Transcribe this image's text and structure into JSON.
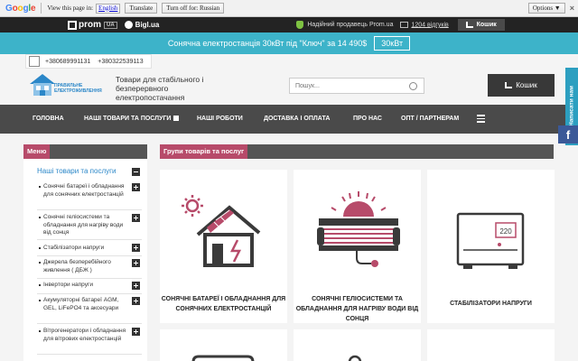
{
  "translate_bar": {
    "logo": "Google",
    "prompt": "View this page in:",
    "language": "English",
    "translate_label": "Translate",
    "turn_off_label": "Turn off for: Russian",
    "options_label": "Options ▼",
    "close": "×"
  },
  "prom_bar": {
    "prom_label": "prom",
    "prom_ua": "UA",
    "bigl_label": "Bigl.ua",
    "seller_text": "Надійний продавець Prom.ua",
    "reviews_text": "1204 відгуків",
    "cart_label": "Кошик"
  },
  "promo": {
    "text": "Сонячна електростанція 30кВт під \"Ключ\" за 14 490$",
    "button_label": "30кВт"
  },
  "phones": [
    "+380689991131",
    "+380322539113"
  ],
  "header": {
    "logo_text_1": "ПРАВИЛЬНЕ",
    "logo_text_2": "ЕЛЕКТРОЖИВЛЕННЯ",
    "tagline": "Товари для стабільного і безперервного електропостачання",
    "search_placeholder": "Пошук...",
    "cart_label": "Кошик"
  },
  "nav": {
    "items": [
      "ГОЛОВНА",
      "НАШІ ТОВАРИ ТА ПОСЛУГИ",
      "НАШІ РОБОТИ",
      "ДОСТАВКА І ОПЛАТА",
      "ПРО НАС",
      "ОПТ / ПАРТНЕРАМ"
    ]
  },
  "side_widget": {
    "write_us": "Написати нам",
    "facebook": "f"
  },
  "sidebar": {
    "title": "Меню",
    "main_item": "Наші товари та послуги",
    "items": [
      "Сонячні батареї і обладнання для сонячних електростанцій",
      "Сонячні геліосистеми та обладнання для нагріву води від сонця",
      "Стабілізатори напруги",
      "Джерела безперебійного живлення ( ДБЖ )",
      "Інвертори напруги",
      "Акумуляторні батареї AGM, GEL, LiFePO4 та аксесуари",
      "Вітрогенератори і обладнання для вітрових електростанцій"
    ]
  },
  "groups": {
    "title": "Групи товарів та послуг",
    "cards": [
      "СОНЯЧНІ БАТАРЕЇ І ОБЛАДНАННЯ ДЛЯ СОНЯЧНИХ ЕЛЕКТРОСТАНЦІЙ",
      "СОНЯЧНІ ГЕЛІОСИСТЕМИ ТА ОБЛАДНАННЯ ДЛЯ НАГРІВУ ВОДИ ВІД СОНЦЯ",
      "СТАБІЛІЗАТОРИ НАПРУГИ"
    ],
    "stabilizer_display": "220"
  },
  "colors": {
    "accent": "#b74b6a",
    "promo": "#3db3c9",
    "nav": "#4a4a4a",
    "link": "#2b87c8",
    "icon_dark": "#3a3a3a"
  }
}
